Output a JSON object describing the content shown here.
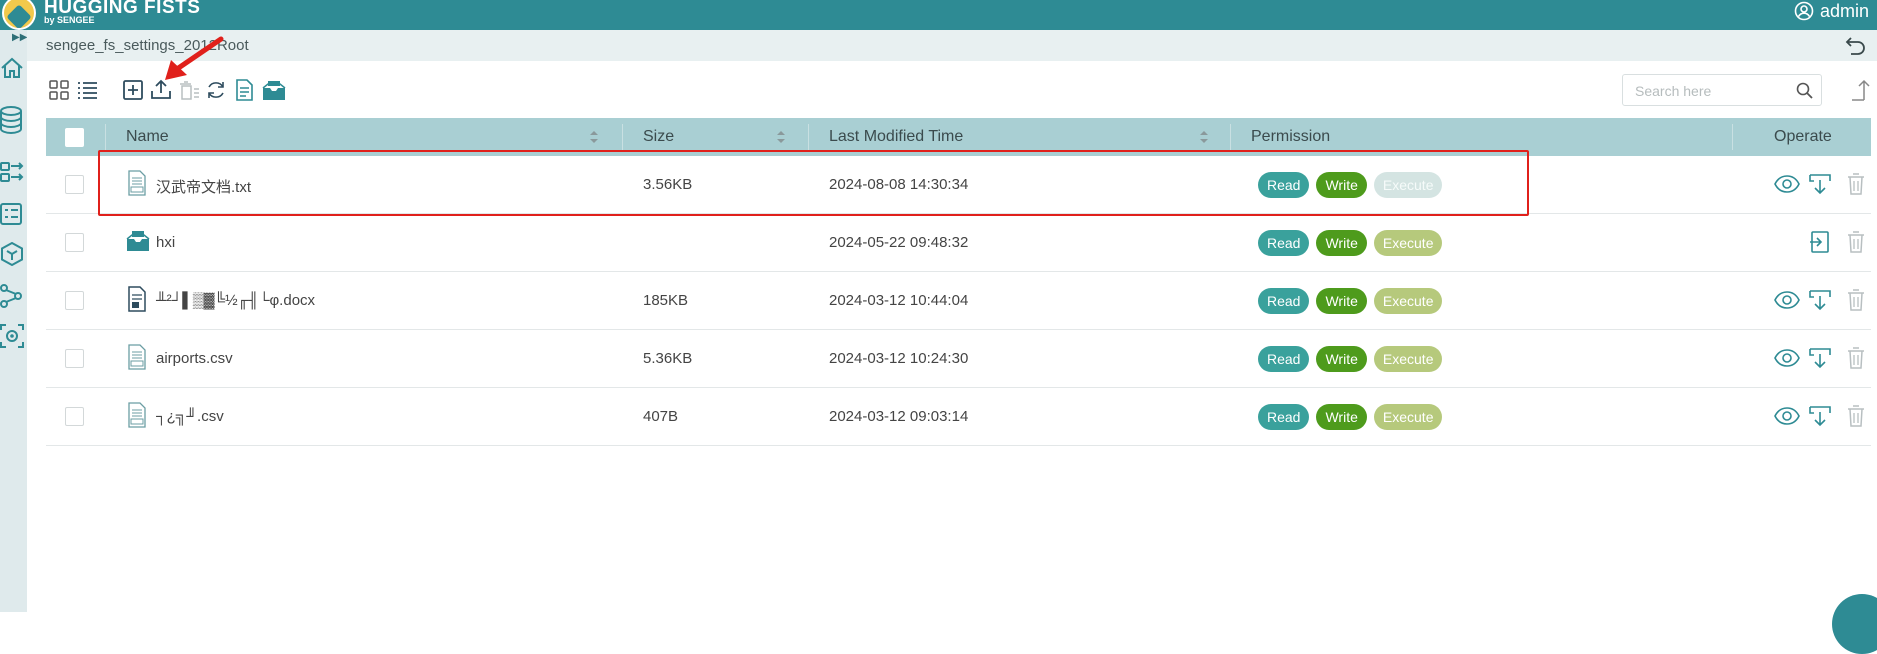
{
  "header": {
    "brand": "HUGGING FISTS",
    "brand_sub": "by SENGEE",
    "user": "admin"
  },
  "breadcrumb": "sengee_fs_settings_2012Root",
  "search": {
    "placeholder": "Search here"
  },
  "table": {
    "columns": {
      "name": "Name",
      "size": "Size",
      "modified": "Last Modified Time",
      "permission": "Permission",
      "operate": "Operate"
    },
    "rows": [
      {
        "name": "汉武帝文档.txt",
        "type": "text",
        "size": "3.56KB",
        "modified": "2024-08-08 14:30:34",
        "read": "Read",
        "write": "Write",
        "execute": "Execute",
        "execute_enabled": false,
        "ops": [
          "eye-icon",
          "download-icon",
          "trash-icon"
        ]
      },
      {
        "name": "hxi",
        "type": "folder",
        "size": "",
        "modified": "2024-05-22 09:48:32",
        "read": "Read",
        "write": "Write",
        "execute": "Execute",
        "execute_enabled": true,
        "ops": [
          "enter-folder-icon",
          "trash-icon"
        ]
      },
      {
        "name": "╨²┘▌▒▓╚½╓╢└φ.docx",
        "type": "docx",
        "size": "185KB",
        "modified": "2024-03-12 10:44:04",
        "read": "Read",
        "write": "Write",
        "execute": "Execute",
        "execute_enabled": true,
        "ops": [
          "eye-icon",
          "download-icon",
          "trash-icon"
        ]
      },
      {
        "name": "airports.csv",
        "type": "text",
        "size": "5.36KB",
        "modified": "2024-03-12 10:24:30",
        "read": "Read",
        "write": "Write",
        "execute": "Execute",
        "execute_enabled": true,
        "ops": [
          "eye-icon",
          "download-icon",
          "trash-icon"
        ]
      },
      {
        "name": "┐¿╗╜.csv",
        "type": "text",
        "size": "407B",
        "modified": "2024-03-12 09:03:14",
        "read": "Read",
        "write": "Write",
        "execute": "Execute",
        "execute_enabled": true,
        "ops": [
          "eye-icon",
          "download-icon",
          "trash-icon"
        ]
      }
    ]
  },
  "colors": {
    "header": "#2e8b94",
    "table_head": "#a9cfd3",
    "read": "#3aa19c",
    "write": "#4e9b1c",
    "execute": "#b6c97c",
    "highlight": "#e0201b"
  }
}
